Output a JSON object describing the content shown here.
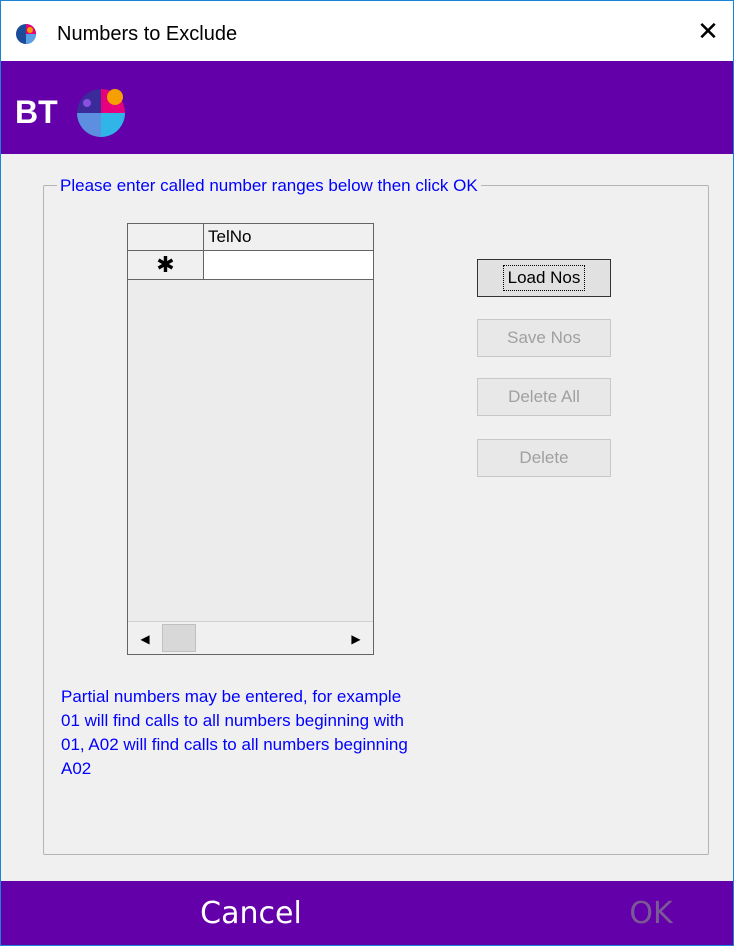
{
  "window": {
    "title": "Numbers to Exclude",
    "close_glyph": "✕"
  },
  "banner": {
    "logo_text": "BT"
  },
  "group": {
    "caption": "Please enter called number ranges below then click OK"
  },
  "grid": {
    "columns": [
      "TelNo"
    ],
    "new_row_marker": "✱",
    "rows": []
  },
  "buttons": {
    "load": "Load Nos",
    "save": "Save Nos",
    "delete_all": "Delete All",
    "delete": "Delete"
  },
  "help_text": "Partial numbers may be entered, for example 01 will find calls to all numbers beginning with 01, A02 will find calls to all numbers beginning A02",
  "footer": {
    "cancel": "Cancel",
    "ok": "OK"
  },
  "colors": {
    "brand_purple": "#6400aa",
    "link_blue": "#0000ff"
  }
}
